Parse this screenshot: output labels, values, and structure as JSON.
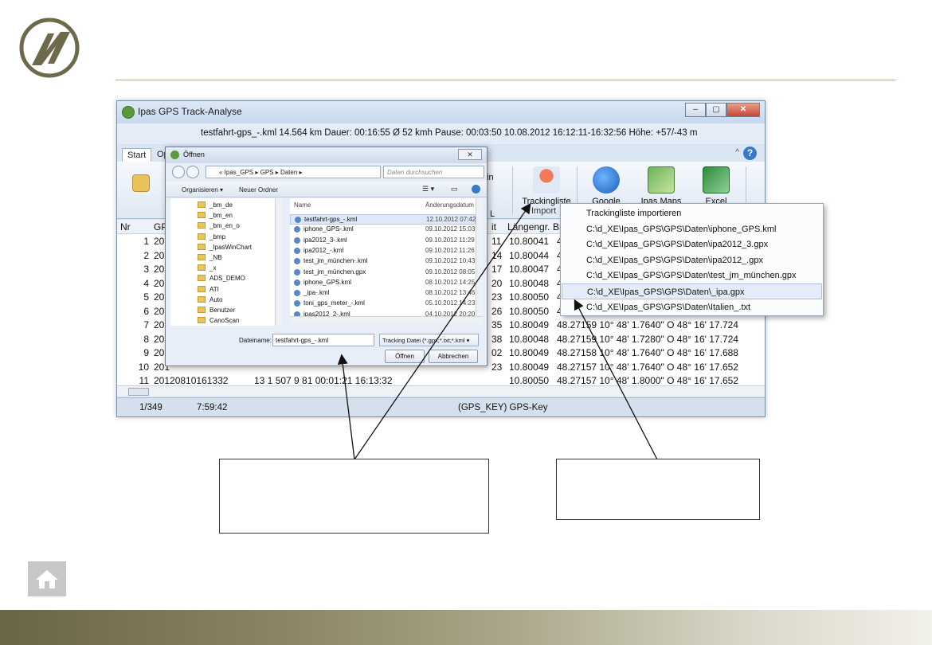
{
  "window": {
    "title": "Ipas GPS Track-Analyse",
    "info": "testfahrt-gps_-.kml  14.564 km  Dauer: 00:16:55  Ø 52 kmh  Pause: 00:03:50  10.08.2012 16:12:11-16:32:56   Höhe: +57/-43 m",
    "min": "–",
    "max": "▢",
    "close": "✕"
  },
  "ribbon": {
    "tabs": [
      "Start",
      "Opt"
    ],
    "help": "?",
    "collapse": "^",
    "buttons": {
      "tracking": "Trackingliste",
      "google": "Google Earth",
      "ipasmaps": "Ipas Maps",
      "excel": "Excel",
      "partial_kml": "in",
      "partial_l": "L"
    },
    "group": "Import"
  },
  "grid": {
    "headers": [
      "Nr",
      "GPS",
      "it",
      "Längengr.",
      "Br"
    ],
    "rows": [
      {
        "nr": "1",
        "gps": "201",
        "t": "11",
        "lon": "10.80041",
        "rest": "4"
      },
      {
        "nr": "2",
        "gps": "201",
        "t": "14",
        "lon": "10.80044",
        "rest": "4"
      },
      {
        "nr": "3",
        "gps": "201",
        "t": "17",
        "lon": "10.80047",
        "rest": "4"
      },
      {
        "nr": "4",
        "gps": "201",
        "t": "20",
        "lon": "10.80048",
        "rest": "4"
      },
      {
        "nr": "5",
        "gps": "201",
        "t": "23",
        "lon": "10.80050",
        "rest": "4"
      },
      {
        "nr": "6",
        "gps": "201",
        "t": "26",
        "lon": "10.80050",
        "rest": "4"
      },
      {
        "nr": "7",
        "gps": "201",
        "t": "35",
        "lon": "10.80049",
        "rest": "48.27159  10° 48' 1.7640\" O        48° 16' 17.724"
      },
      {
        "nr": "8",
        "gps": "201",
        "t": "38",
        "lon": "10.80048",
        "rest": "48.27159  10° 48' 1.7280\" O        48° 16' 17.724"
      },
      {
        "nr": "9",
        "gps": "201",
        "t": "02",
        "lon": "10.80049",
        "rest": "48.27158  10° 48' 1.7640\" O        48° 16' 17.688"
      },
      {
        "nr": "10",
        "gps": "201",
        "t": "23",
        "lon": "10.80049",
        "rest": "48.27157  10° 48' 1.7640\" O        48° 16' 17.652"
      },
      {
        "nr": "11",
        "gps": "20120810161332",
        "t": "",
        "lon": "10.80050",
        "rest": "48.27157  10° 48' 1.8000\" O        48° 16' 17.652"
      }
    ],
    "row11_mid": "13        1    507                          9        81   00:01:21   16:13:32"
  },
  "status": {
    "pos": "1/349",
    "time": "7:59:42",
    "key": "(GPS_KEY)  GPS-Key"
  },
  "dialog": {
    "title": "Öffnen",
    "close": "✕",
    "breadcrumb": "« Ipas_GPS  ▸  GPS  ▸  Daten  ▸",
    "search_placeholder": "Daten durchsuchen",
    "organize": "Organisieren ▾",
    "new_folder": "Neuer Ordner",
    "col_name": "Name",
    "col_date": "Änderungsdatum",
    "folders": [
      "_bm_de",
      "_bm_en",
      "_bm_en_o",
      "_bmp",
      "_IpasWinChart",
      "_NB",
      "_x",
      "ADS_DEMO",
      "ATI",
      "Auto",
      "Benutzer",
      "CanoScan"
    ],
    "files": [
      {
        "name": "testfahrt-gps_-.kml",
        "date": "12.10.2012 07:42"
      },
      {
        "name": "iphone_GPS-.kml",
        "date": "09.10.2012 15:03"
      },
      {
        "name": "ipa2012_3-.kml",
        "date": "09.10.2012 11:29"
      },
      {
        "name": "ipa2012_-.kml",
        "date": "09.10.2012 11:26"
      },
      {
        "name": "test_jm_münchen-.kml",
        "date": "09.10.2012 10:43"
      },
      {
        "name": "test_jm_münchen.gpx",
        "date": "09.10.2012 08:05"
      },
      {
        "name": "iphone_GPS.kml",
        "date": "08.10.2012 14:25"
      },
      {
        "name": "_ipa-.kml",
        "date": "08.10.2012 13:46"
      },
      {
        "name": "toni_gps_meter_-.kml",
        "date": "05.10.2012 14:23"
      },
      {
        "name": "ipas2012_2-.kml",
        "date": "04.10.2012 20:20"
      }
    ],
    "filename_label": "Dateiname:",
    "filename": "testfahrt-gps_-.kml",
    "filetype": "Tracking Datei (*.gpx;*.txt;*.kml ▾",
    "open": "Öffnen",
    "cancel": "Abbrechen"
  },
  "menu": {
    "items": [
      "Trackingliste importieren",
      "C:\\d_XE\\Ipas_GPS\\GPS\\Daten\\iphone_GPS.kml",
      "C:\\d_XE\\Ipas_GPS\\GPS\\Daten\\ipa2012_3.gpx",
      "C:\\d_XE\\Ipas_GPS\\GPS\\Daten\\ipa2012_.gpx",
      "C:\\d_XE\\Ipas_GPS\\GPS\\Daten\\test_jm_münchen.gpx",
      "C:\\d_XE\\Ipas_GPS\\GPS\\Daten\\_ipa.gpx",
      "C:\\d_XE\\Ipas_GPS\\GPS\\Daten\\Italien_.txt"
    ]
  },
  "colors": {
    "footer_dark": "#6b6548",
    "logo": "#6d6a4c",
    "accent": "#3a78c8"
  }
}
